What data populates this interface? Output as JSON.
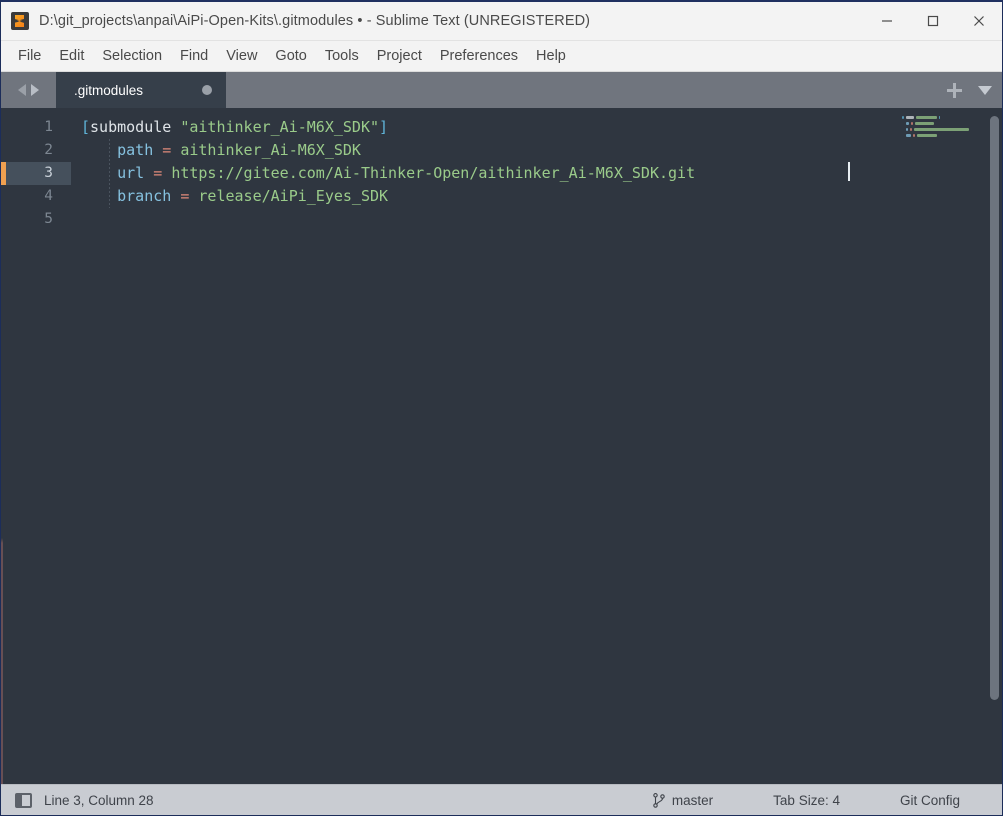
{
  "window": {
    "title": "D:\\git_projects\\anpai\\AiPi-Open-Kits\\.gitmodules • - Sublime Text (UNREGISTERED)",
    "logo_icon": "sublime-text-logo-icon",
    "minimize_icon": "minimize-icon",
    "maximize_icon": "maximize-icon",
    "close_icon": "close-icon",
    "accent_color": "#f0a050",
    "titlebar_bg": "#f3f3f3",
    "editor_bg": "#2f3640",
    "tabbar_bg": "#70757e",
    "statusbar_bg": "#c9ccd2"
  },
  "menubar": {
    "items": [
      {
        "label": "File"
      },
      {
        "label": "Edit"
      },
      {
        "label": "Selection"
      },
      {
        "label": "Find"
      },
      {
        "label": "View"
      },
      {
        "label": "Goto"
      },
      {
        "label": "Tools"
      },
      {
        "label": "Project"
      },
      {
        "label": "Preferences"
      },
      {
        "label": "Help"
      }
    ]
  },
  "tabbar": {
    "prev_icon": "arrow-left-icon",
    "next_icon": "arrow-right-icon",
    "tabs": [
      {
        "label": ".gitmodules",
        "dirty": true,
        "dirty_icon": "unsaved-dot-icon",
        "active": true
      }
    ],
    "new_tab_icon": "plus-icon",
    "tab_menu_icon": "chevron-down-icon"
  },
  "editor": {
    "language": "Git Config",
    "line_numbers": [
      "1",
      "2",
      "3",
      "4",
      "5"
    ],
    "active_line": 3,
    "lines": [
      {
        "number": "1",
        "tokens": [
          {
            "text": "[",
            "type": "bracket"
          },
          {
            "text": "submodule",
            "type": "section"
          },
          {
            "text": " ",
            "type": "plain"
          },
          {
            "text": "\"aithinker_Ai-M6X_SDK\"",
            "type": "string"
          },
          {
            "text": "]",
            "type": "bracket"
          }
        ],
        "plain": "[submodule \"aithinker_Ai-M6X_SDK\"]"
      },
      {
        "number": "2",
        "tokens": [
          {
            "text": "    ",
            "type": "plain"
          },
          {
            "text": "path",
            "type": "key"
          },
          {
            "text": " ",
            "type": "plain"
          },
          {
            "text": "=",
            "type": "eq"
          },
          {
            "text": " ",
            "type": "plain"
          },
          {
            "text": "aithinker_Ai-M6X_SDK",
            "type": "value"
          }
        ],
        "plain": "    path = aithinker_Ai-M6X_SDK"
      },
      {
        "number": "3",
        "tokens": [
          {
            "text": "    ",
            "type": "plain"
          },
          {
            "text": "url",
            "type": "key"
          },
          {
            "text": " ",
            "type": "plain"
          },
          {
            "text": "=",
            "type": "eq"
          },
          {
            "text": " ",
            "type": "plain"
          },
          {
            "text": "https://gitee.com/Ai-Thinker-Open/aithinker_Ai-M6X_SDK.git",
            "type": "value"
          }
        ],
        "plain": "    url = https://gitee.com/Ai-Thinker-Open/aithinker_Ai-M6X_SDK.git"
      },
      {
        "number": "4",
        "tokens": [
          {
            "text": "    ",
            "type": "plain"
          },
          {
            "text": "branch",
            "type": "key"
          },
          {
            "text": " ",
            "type": "plain"
          },
          {
            "text": "=",
            "type": "eq"
          },
          {
            "text": " ",
            "type": "plain"
          },
          {
            "text": "release/AiPi_Eyes_SDK",
            "type": "value"
          }
        ],
        "plain": "    branch = release/AiPi_Eyes_SDK"
      },
      {
        "number": "5",
        "tokens": [],
        "plain": ""
      }
    ],
    "colors": {
      "bracket": "#5fb4d8",
      "section": "#dfe4e8",
      "string": "#9acb8a",
      "key": "#86c2e0",
      "equals": "#e08a7a",
      "value": "#9acb8a",
      "line_number": "#7c8691",
      "active_line_bg": "#45505c"
    }
  },
  "minimap": {
    "visible": true,
    "scrollbar_icon": "vertical-scrollbar"
  },
  "statusbar": {
    "sidebar_toggle_icon": "sidebar-toggle-icon",
    "cursor_position": "Line 3, Column 28",
    "branch_icon": "git-branch-icon",
    "branch": "master",
    "tab_size": "Tab Size: 4",
    "syntax": "Git Config"
  }
}
